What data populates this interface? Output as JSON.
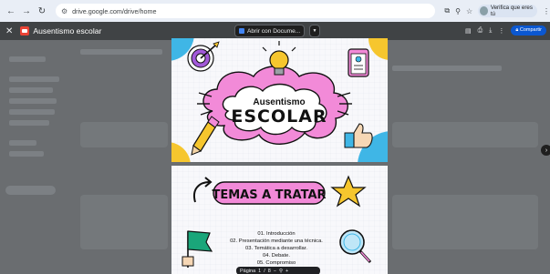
{
  "browser": {
    "url": "drive.google.com/drive/home",
    "verify_label": "Verifica que eres tú"
  },
  "viewer": {
    "file_title": "Ausentismo escolar",
    "open_with_label": "Abrir con Docume...",
    "share_label": "Compartir"
  },
  "slide1": {
    "title_top": "Ausentismo",
    "title_main": "ESCOLAR"
  },
  "slide2": {
    "heading": "TEMAS A TRATAR",
    "items": [
      "01. Introducción",
      "02. Presentación mediante una técnica.",
      "03. Temática a desarrollar.",
      "04. Debate.",
      "05. Compromiso"
    ]
  },
  "pager": {
    "label": "Página",
    "current": "1",
    "separator": "/",
    "total": "8",
    "minus": "−",
    "plus": "+"
  },
  "colors": {
    "chrome_bg": "#e9eef6",
    "viewer_dim": "#3b3f45",
    "accent_pink": "#f28ad8",
    "accent_blue": "#3fb6e6",
    "accent_yellow": "#f6c62e",
    "share_blue": "#0b57d0"
  }
}
